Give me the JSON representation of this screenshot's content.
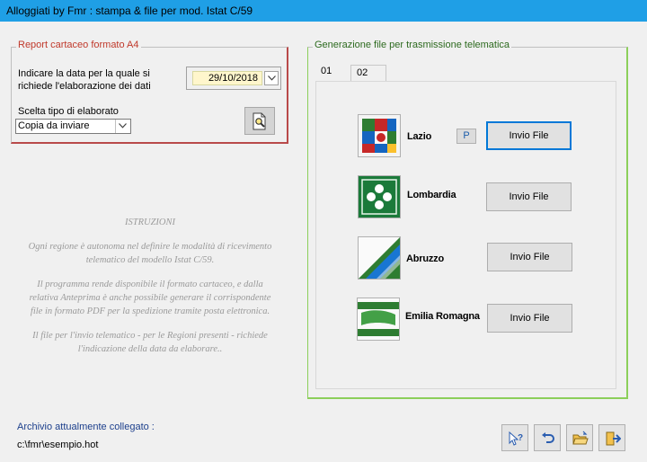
{
  "window": {
    "title": "Alloggiati by Fmr : stampa & file per mod. Istat C/59"
  },
  "report": {
    "legend": "Report cartaceo formato A4",
    "date_prompt_line1": "Indicare la data per la quale si",
    "date_prompt_line2": "richiede l'elaborazione dei dati",
    "date_value": "29/10/2018",
    "type_label": "Scelta tipo di elaborato",
    "type_value": "Copia da inviare",
    "preview_icon": "preview-icon"
  },
  "instructions": {
    "title": "ISTRUZIONI",
    "p1_l1": "Ogni regione è autonoma nel definire le modalità di ricevimento",
    "p1_l2": "telematico del modello Istat C/59.",
    "p2_l1": "Il programma rende disponibile il formato cartaceo, e dalla",
    "p2_l2": "relativa Anteprima è anche possibile generare il corrispondente",
    "p2_l3": "file in formato PDF per la spedizione tramite posta elettronica.",
    "p3_l1": "Il file per l'invio telematico - per le Regioni presenti - richiede",
    "p3_l2": "l'indicazione della data da elaborare.."
  },
  "telematica": {
    "legend": "Generazione file per trasmissione telematica",
    "tabs": [
      "01",
      "02"
    ],
    "p_badge": "P",
    "regions": [
      {
        "name": "Lazio",
        "button": "Invio File",
        "icon": "lazio-icon"
      },
      {
        "name": "Lombardia",
        "button": "Invio File",
        "icon": "lombardia-icon"
      },
      {
        "name": "Abruzzo",
        "button": "Invio File",
        "icon": "abruzzo-icon"
      },
      {
        "name": "Emilia Romagna",
        "button": "Invio File",
        "icon": "emilia-romagna-icon"
      }
    ]
  },
  "footer": {
    "archive_label": "Archivio attualmente collegato :",
    "archive_path": "c:\\fmr\\esempio.hot",
    "buttons": [
      "help-icon",
      "undo-icon",
      "open-folder-icon",
      "exit-icon"
    ]
  },
  "colors": {
    "titlebar": "#1f9fe6",
    "red_group": "#b94a4a",
    "green_group": "#8ccf5a",
    "date_field": "#fff6cc",
    "focus_border": "#0078d7"
  }
}
